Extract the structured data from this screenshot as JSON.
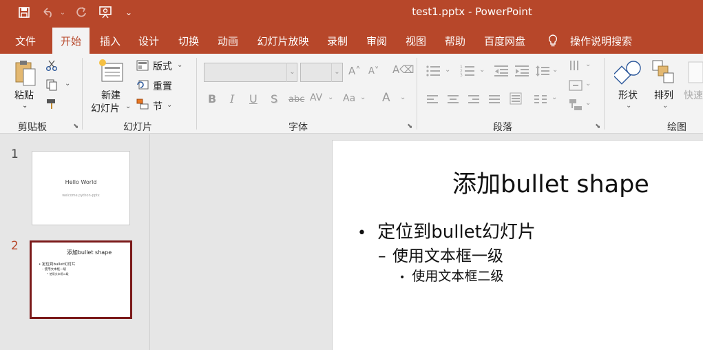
{
  "window": {
    "title": "test1.pptx  -  PowerPoint"
  },
  "qat": {
    "save_icon": "save-icon",
    "undo_icon": "undo-icon",
    "redo_icon": "redo-icon",
    "present_icon": "present-icon",
    "customize_icon": "customize-icon"
  },
  "tabs": [
    {
      "label": "文件"
    },
    {
      "label": "开始"
    },
    {
      "label": "插入"
    },
    {
      "label": "设计"
    },
    {
      "label": "切换"
    },
    {
      "label": "动画"
    },
    {
      "label": "幻灯片放映"
    },
    {
      "label": "录制"
    },
    {
      "label": "审阅"
    },
    {
      "label": "视图"
    },
    {
      "label": "帮助"
    },
    {
      "label": "百度网盘"
    }
  ],
  "tell_me": {
    "label": "操作说明搜索"
  },
  "ribbon": {
    "clipboard": {
      "paste": "粘贴",
      "group": "剪贴板"
    },
    "slides": {
      "new_line1": "新建",
      "new_line2": "幻灯片",
      "layout": "版式",
      "reset": "重置",
      "section": "节",
      "group": "幻灯片"
    },
    "font": {
      "group": "字体",
      "bold": "B",
      "italic": "I",
      "underline": "U",
      "shadow": "S",
      "strike": "abc",
      "spacing": "AV",
      "case": "Aa",
      "color": "A"
    },
    "paragraph": {
      "group": "段落"
    },
    "drawing": {
      "shape": "形状",
      "arrange": "排列",
      "quick": "快速",
      "group": "绘图"
    }
  },
  "thumbnails": [
    {
      "number": "1",
      "title": "Hello World",
      "subtitle": "welcome python-pptx"
    },
    {
      "number": "2",
      "title": "添加bullet shape",
      "l1": "• 定位到bullet幻灯片",
      "l2": "– 使用文本框一级",
      "l3": "• 使用文本框二级"
    }
  ],
  "slide": {
    "title": "添加bullet shape",
    "bullets": [
      {
        "level": 1,
        "text": "定位到bullet幻灯片"
      },
      {
        "level": 2,
        "text": "使用文本框一级"
      },
      {
        "level": 3,
        "text": "使用文本框二级"
      }
    ]
  },
  "colors": {
    "accent": "#b7472a",
    "selection": "#7b1a1a"
  }
}
